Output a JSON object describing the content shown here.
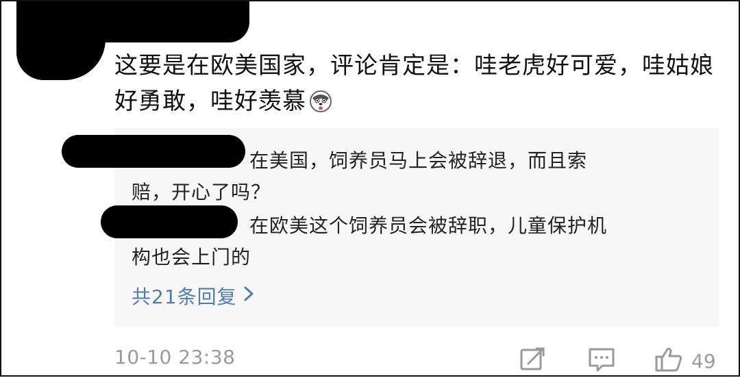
{
  "comment": {
    "text": "这要是在欧美国家，评论肯定是：哇老虎好可爱，哇姑娘好勇敢，哇好羡慕",
    "emoji_icon": "husky-emoji-icon"
  },
  "replies": [
    {
      "text": "在美国，饲养员马上会被辞退，而且索赔，开心了吗？"
    },
    {
      "text": "在欧美这个饲养员会被辞职，儿童保护机构也会上门的"
    }
  ],
  "more_replies_label": "共21条回复",
  "footer": {
    "timestamp": "10-10 23:38",
    "like_count": "49"
  },
  "colors": {
    "link": "#507daf",
    "meta": "#9a9a9a",
    "reply_bg": "#f7f7f7"
  }
}
